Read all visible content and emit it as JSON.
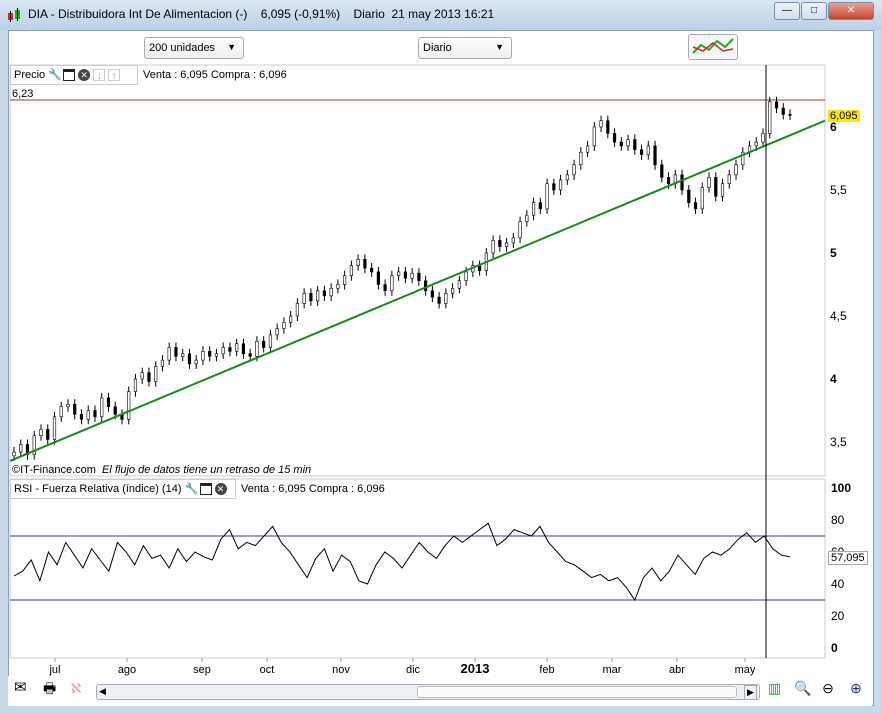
{
  "window": {
    "title": "DIA - Distribuidora Int De Alimentacion (-)    6,095 (-0,91%)    Diario  21 may 2013 16:21",
    "minimize": "—",
    "maximize": "□",
    "close": "✕"
  },
  "toolbar": {
    "units": "200 unidades",
    "period": "Diario"
  },
  "price_panel": {
    "label": "Precio",
    "quote": "Venta : 6,095 Compra : 6,096",
    "high_label": "6,23",
    "last_label": "6,095",
    "footer_brand": "©IT-Finance.com",
    "footer_note": "El flujo de datos tiene un retraso de 15 min"
  },
  "rsi_panel": {
    "label": "RSI - Fuerza Relativa (índice) (14)",
    "quote": "Venta : 6,095 Compra : 6,096",
    "last_label": "57,095"
  },
  "colors": {
    "trendline": "#1a8a1a",
    "high_line": "#b03030",
    "rsi_band": "#3a3a8a",
    "last_bg": "#ffe600"
  },
  "chart_data": [
    {
      "type": "candlestick",
      "title": "Precio",
      "y_ticks": [
        "6",
        "5,5",
        "5",
        "4,5",
        "4",
        "3,5"
      ],
      "y_tick_values": [
        6,
        5.5,
        5,
        4.5,
        4,
        3.5
      ],
      "high": 6.23,
      "last": 6.095,
      "x_labels": [
        "jul",
        "ago",
        "sep",
        "oct",
        "nov",
        "dic",
        "2013",
        "feb",
        "mar",
        "abr",
        "may"
      ],
      "closes": [
        3.42,
        3.48,
        3.4,
        3.55,
        3.6,
        3.52,
        3.7,
        3.78,
        3.8,
        3.72,
        3.68,
        3.75,
        3.7,
        3.85,
        3.78,
        3.72,
        3.68,
        3.9,
        4.0,
        4.05,
        3.98,
        4.1,
        4.15,
        4.25,
        4.18,
        4.2,
        4.12,
        4.15,
        4.22,
        4.18,
        4.2,
        4.25,
        4.22,
        4.28,
        4.2,
        4.18,
        4.3,
        4.25,
        4.35,
        4.4,
        4.45,
        4.5,
        4.6,
        4.68,
        4.62,
        4.7,
        4.66,
        4.72,
        4.75,
        4.82,
        4.9,
        4.95,
        4.88,
        4.85,
        4.75,
        4.7,
        4.82,
        4.85,
        4.8,
        4.84,
        4.78,
        4.7,
        4.65,
        4.6,
        4.68,
        4.72,
        4.78,
        4.85,
        4.9,
        4.86,
        5.0,
        5.1,
        5.05,
        5.08,
        5.12,
        5.25,
        5.3,
        5.4,
        5.35,
        5.55,
        5.5,
        5.58,
        5.62,
        5.7,
        5.8,
        5.85,
        6.0,
        6.05,
        5.95,
        5.88,
        5.85,
        5.9,
        5.82,
        5.78,
        5.85,
        5.7,
        5.6,
        5.55,
        5.62,
        5.5,
        5.4,
        5.35,
        5.52,
        5.6,
        5.45,
        5.55,
        5.62,
        5.7,
        5.8,
        5.85,
        5.88,
        5.95,
        6.2,
        6.15,
        6.1,
        6.095
      ],
      "trendline": {
        "start": 3.35,
        "end": 6.05
      }
    },
    {
      "type": "line",
      "title": "RSI - Fuerza Relativa (índice) (14)",
      "y_ticks": [
        "100",
        "80",
        "60",
        "40",
        "20",
        "0"
      ],
      "y_tick_values": [
        100,
        80,
        60,
        40,
        20,
        0
      ],
      "bands": [
        70,
        30
      ],
      "values": [
        45,
        48,
        55,
        42,
        60,
        52,
        66,
        58,
        50,
        62,
        55,
        48,
        66,
        60,
        52,
        64,
        56,
        58,
        50,
        62,
        54,
        60,
        57,
        55,
        68,
        74,
        62,
        66,
        64,
        70,
        76,
        66,
        60,
        52,
        44,
        56,
        62,
        48,
        58,
        54,
        42,
        40,
        52,
        60,
        56,
        50,
        58,
        66,
        60,
        56,
        64,
        70,
        66,
        70,
        74,
        78,
        64,
        68,
        74,
        72,
        70,
        76,
        66,
        60,
        54,
        52,
        48,
        44,
        46,
        42,
        44,
        38,
        30,
        44,
        50,
        42,
        48,
        58,
        52,
        46,
        56,
        60,
        58,
        62,
        68,
        72,
        66,
        70,
        62,
        58,
        57
      ]
    }
  ]
}
